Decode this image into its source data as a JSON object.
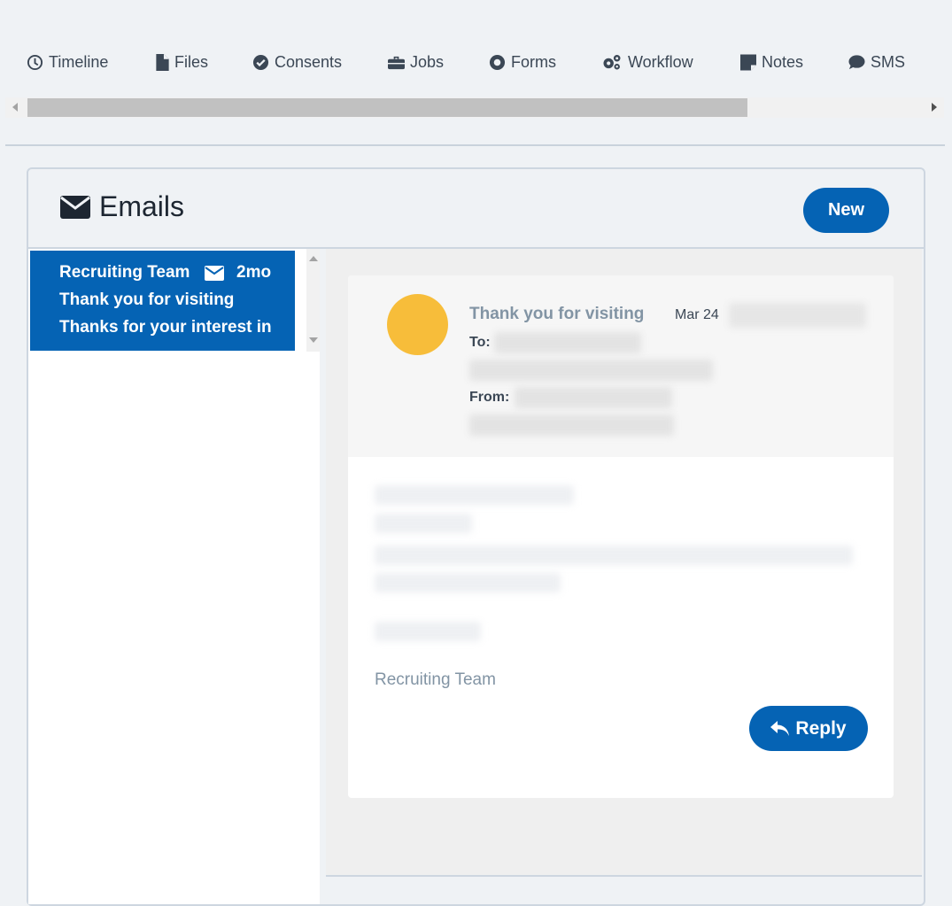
{
  "tabs": [
    {
      "label": "Timeline",
      "icon": "clock-icon"
    },
    {
      "label": "Files",
      "icon": "file-icon"
    },
    {
      "label": "Consents",
      "icon": "check-circle-icon"
    },
    {
      "label": "Jobs",
      "icon": "briefcase-icon"
    },
    {
      "label": "Forms",
      "icon": "dot-circle-icon"
    },
    {
      "label": "Workflow",
      "icon": "gears-icon"
    },
    {
      "label": "Notes",
      "icon": "sticky-note-icon"
    },
    {
      "label": "SMS",
      "icon": "speech-bubble-icon"
    }
  ],
  "panel": {
    "title": "Emails",
    "new_label": "New"
  },
  "email_list": [
    {
      "sender": "Recruiting Team",
      "age": "2mo",
      "subject": "Thank you for visiting",
      "preview": "Thanks for your interest in"
    }
  ],
  "message": {
    "subject": "Thank you for visiting",
    "date": "Mar 24",
    "to_label": "To:",
    "from_label": "From:",
    "signature": "Recruiting Team",
    "reply_label": "Reply"
  },
  "colors": {
    "accent": "#0563b4",
    "avatar": "#f7bd3a",
    "muted_text": "#8294a4"
  }
}
